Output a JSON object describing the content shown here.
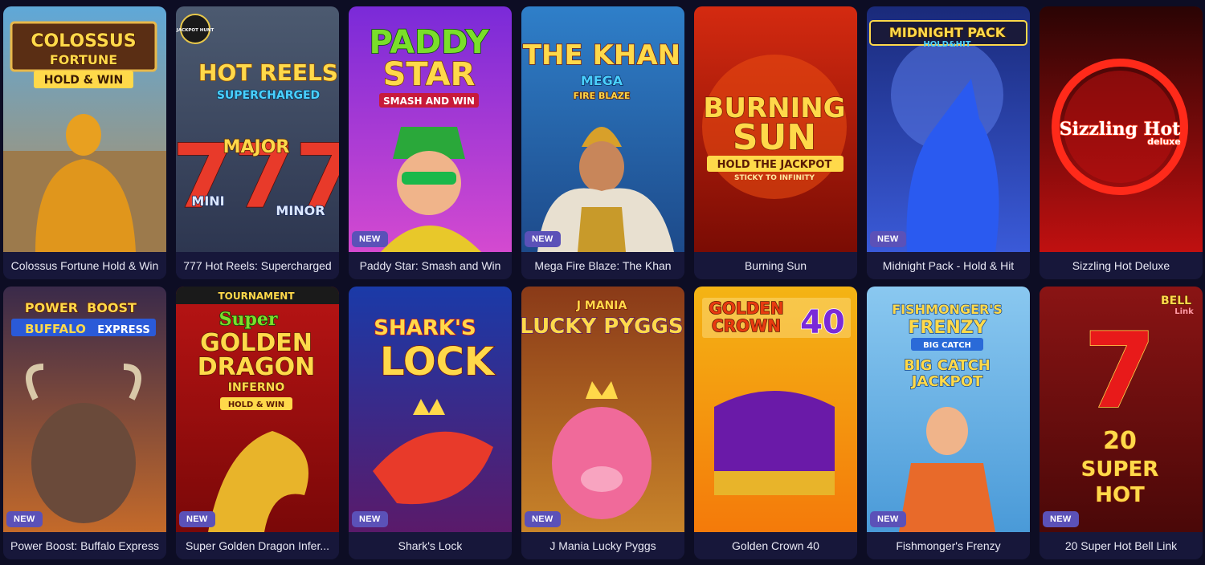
{
  "badge_label": "NEW",
  "games": [
    {
      "title": "Colossus Fortune Hold & Win",
      "is_new": false,
      "logo": [
        "COLOSSUS",
        "FORTUNE",
        "HOLD & WIN"
      ],
      "colors": [
        "#5fa8d8",
        "#b58d5a"
      ]
    },
    {
      "title": "777 Hot Reels: Supercharged",
      "is_new": false,
      "logo": [
        "HOT REELS",
        "SUPERCHARGED",
        "MAJOR",
        "MINI",
        "MINOR",
        "JACKPOT HUNT"
      ],
      "colors": [
        "#4c5a70",
        "#2d3650"
      ]
    },
    {
      "title": "Paddy Star: Smash and Win",
      "is_new": true,
      "logo": [
        "PADDY",
        "STAR",
        "SMASH AND WIN"
      ],
      "colors": [
        "#7a2ad8",
        "#d44ad0"
      ]
    },
    {
      "title": "Mega Fire Blaze: The Khan",
      "is_new": true,
      "logo": [
        "THE KHAN",
        "MEGA",
        "FIRE BLAZE"
      ],
      "colors": [
        "#2f7fc9",
        "#1d4a8a"
      ]
    },
    {
      "title": "Burning Sun",
      "is_new": false,
      "logo": [
        "BURNING",
        "SUN",
        "HOLD THE JACKPOT",
        "STICKY TO INFINITY"
      ],
      "colors": [
        "#d42a10",
        "#7a0c04"
      ]
    },
    {
      "title": "Midnight Pack - Hold & Hit",
      "is_new": true,
      "logo": [
        "MIDNIGHT PACK",
        "HOLD&HIT"
      ],
      "colors": [
        "#1a2a7a",
        "#3a5ad8"
      ]
    },
    {
      "title": "Sizzling Hot Deluxe",
      "is_new": false,
      "logo": [
        "Sizzling Hot",
        "deluxe"
      ],
      "colors": [
        "#2a0404",
        "#c01010"
      ]
    },
    {
      "title": "Power Boost: Buffalo Express",
      "is_new": true,
      "logo": [
        "POWER",
        "BOOST",
        "BUFFALO",
        "EXPRESS"
      ],
      "colors": [
        "#3a2a4a",
        "#c46a2a"
      ]
    },
    {
      "title": "Super Golden Dragon Infer...",
      "is_new": true,
      "logo": [
        "TOURNAMENT",
        "Super",
        "GOLDEN",
        "DRAGON",
        "INFERNO",
        "HOLD & WIN"
      ],
      "colors": [
        "#b81414",
        "#7a0808"
      ]
    },
    {
      "title": "Shark's Lock",
      "is_new": true,
      "logo": [
        "SHARK'S",
        "LOCK"
      ],
      "colors": [
        "#1a3aa8",
        "#5a1a6a"
      ]
    },
    {
      "title": "J Mania Lucky Pyggs",
      "is_new": true,
      "logo": [
        "J MANIA",
        "LUCKY PYGGS"
      ],
      "colors": [
        "#8a3a18",
        "#c8842a"
      ]
    },
    {
      "title": "Golden Crown 40",
      "is_new": false,
      "logo": [
        "GOLDEN",
        "CROWN",
        "40"
      ],
      "colors": [
        "#f4b414",
        "#f47a0a"
      ]
    },
    {
      "title": "Fishmonger's Frenzy",
      "is_new": true,
      "logo": [
        "FISHMONGER'S",
        "FRENZY",
        "BIG CATCH",
        "BIG CATCH",
        "JACKPOT"
      ],
      "colors": [
        "#8ac8f0",
        "#4a9ad8"
      ]
    },
    {
      "title": "20 Super Hot Bell Link",
      "is_new": true,
      "logo": [
        "BELL",
        "Link",
        "20",
        "SUPER",
        "HOT"
      ],
      "colors": [
        "#8a1414",
        "#4a0808"
      ]
    }
  ]
}
